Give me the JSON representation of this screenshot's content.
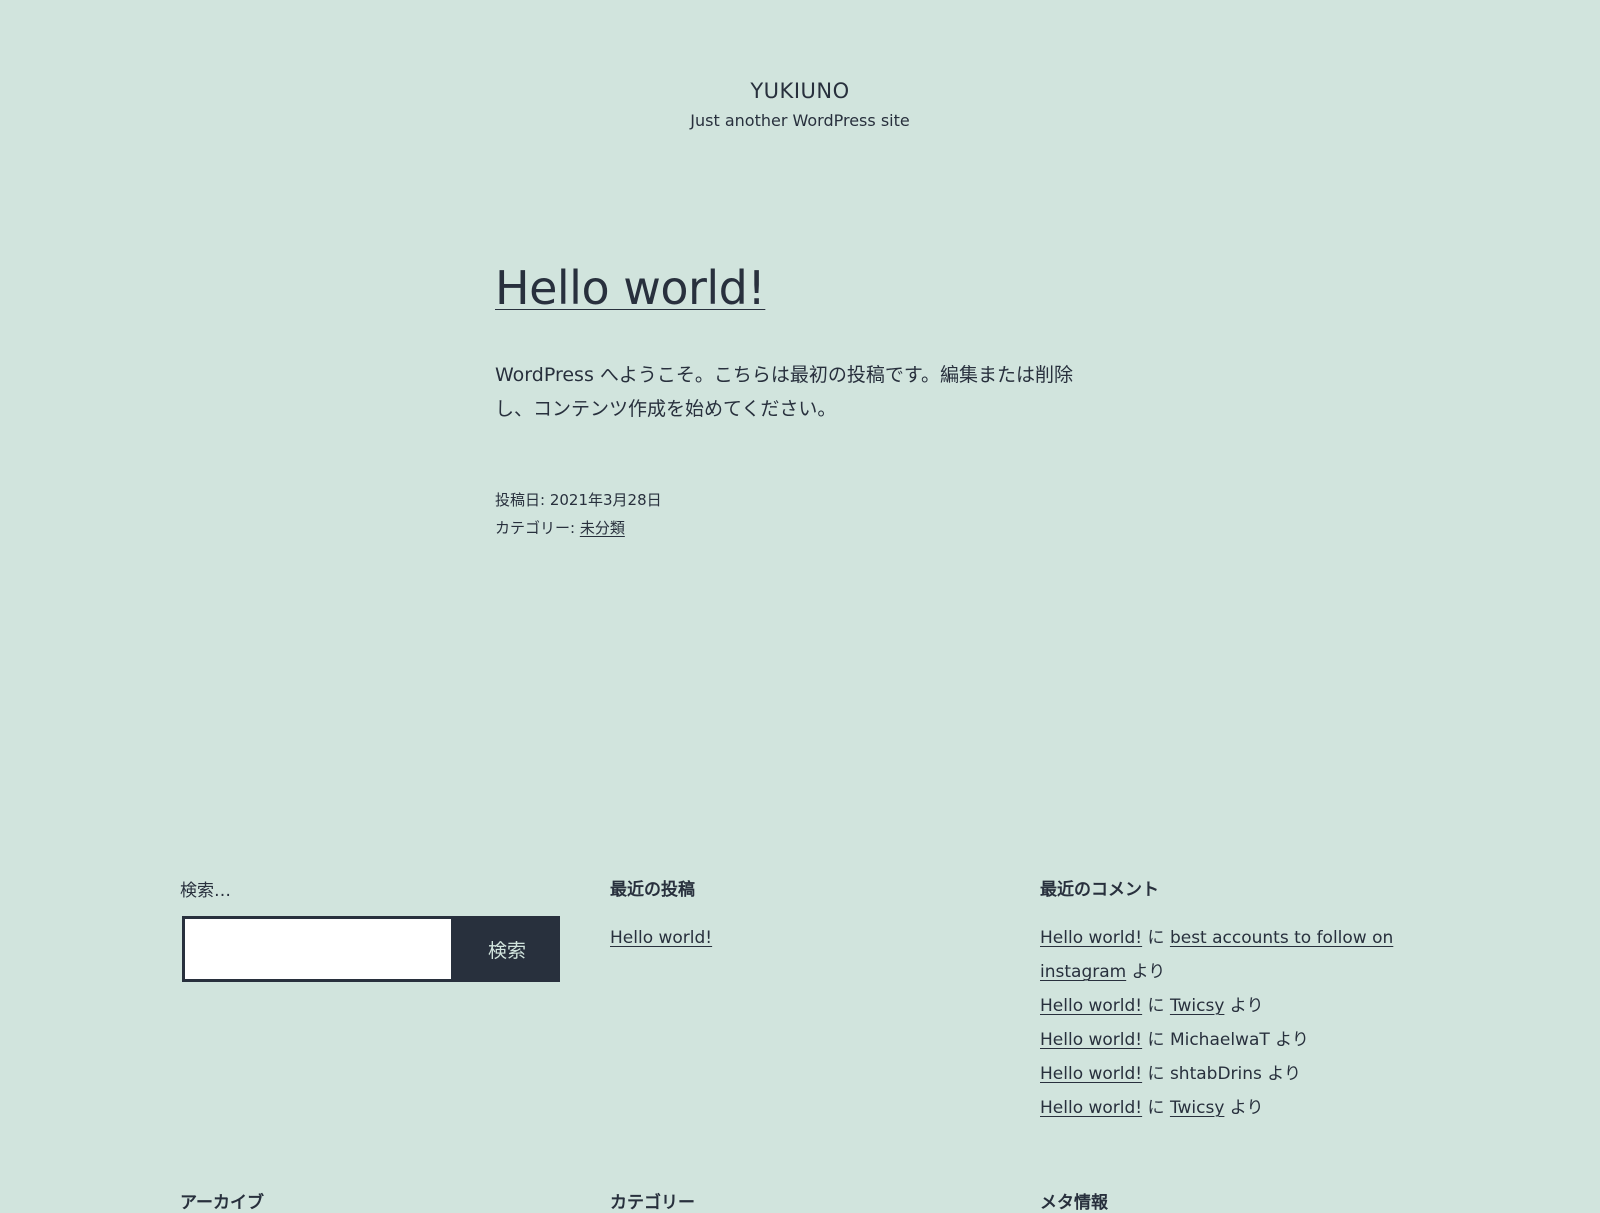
{
  "site": {
    "title": "YUKIUNO",
    "description": "Just another WordPress site"
  },
  "post": {
    "title": "Hello world!",
    "content": "WordPress へようこそ。こちらは最初の投稿です。編集または削除し、コンテンツ作成を始めてください。",
    "date_label": "投稿日: ",
    "date": "2021年3月28日",
    "category_label": "カテゴリー: ",
    "category": "未分類"
  },
  "search": {
    "label": "検索…",
    "input_value": "",
    "button_label": "検索"
  },
  "recent_posts": {
    "title": "最近の投稿",
    "items": [
      "Hello world!"
    ]
  },
  "recent_comments": {
    "title": "最近のコメント",
    "connector_ni": " に ",
    "connector_yori": " より",
    "items": [
      {
        "post": "Hello world!",
        "author": "best accounts to follow on instagram",
        "author_linked": true
      },
      {
        "post": "Hello world!",
        "author": "Twicsy",
        "author_linked": true
      },
      {
        "post": "Hello world!",
        "author": "MichaelwaT",
        "author_linked": false
      },
      {
        "post": "Hello world!",
        "author": "shtabDrins",
        "author_linked": false
      },
      {
        "post": "Hello world!",
        "author": "Twicsy",
        "author_linked": true
      }
    ]
  },
  "bottom_widgets": {
    "archive_title": "アーカイブ",
    "category_title": "カテゴリー",
    "meta_title": "メタ情報"
  }
}
